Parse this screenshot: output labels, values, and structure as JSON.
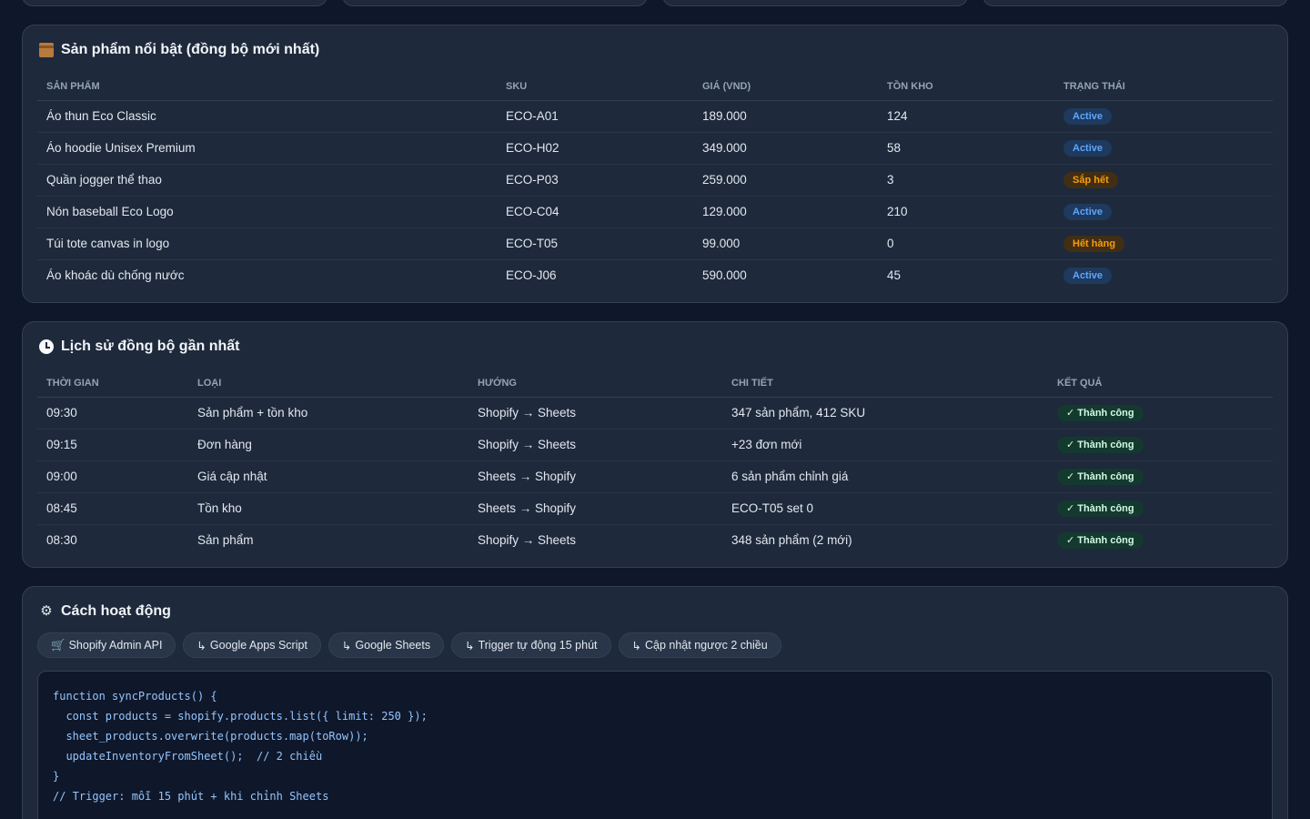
{
  "products": {
    "title": "Sản phẩm nổi bật (đồng bộ mới nhất)",
    "icon": "package-icon",
    "headers": [
      "SẢN PHẨM",
      "SKU",
      "GIÁ (VND)",
      "TỒN KHO",
      "TRẠNG THÁI"
    ],
    "rows": [
      {
        "name": "Áo thun Eco Classic",
        "sku": "ECO-A01",
        "price": "189.000",
        "stock": "124",
        "status": "Active",
        "status_kind": "active"
      },
      {
        "name": "Áo hoodie Unisex Premium",
        "sku": "ECO-H02",
        "price": "349.000",
        "stock": "58",
        "status": "Active",
        "status_kind": "active"
      },
      {
        "name": "Quần jogger thể thao",
        "sku": "ECO-P03",
        "price": "259.000",
        "stock": "3",
        "status": "Sắp hết",
        "status_kind": "warn"
      },
      {
        "name": "Nón baseball Eco Logo",
        "sku": "ECO-C04",
        "price": "129.000",
        "stock": "210",
        "status": "Active",
        "status_kind": "active"
      },
      {
        "name": "Túi tote canvas in logo",
        "sku": "ECO-T05",
        "price": "99.000",
        "stock": "0",
        "status": "Hết hàng",
        "status_kind": "warn"
      },
      {
        "name": "Áo khoác dù chống nước",
        "sku": "ECO-J06",
        "price": "590.000",
        "stock": "45",
        "status": "Active",
        "status_kind": "active"
      }
    ]
  },
  "history": {
    "title": "Lịch sử đồng bộ gần nhất",
    "icon": "clock-icon",
    "headers": [
      "THỜI GIAN",
      "LOẠI",
      "HƯỚNG",
      "CHI TIẾT",
      "KẾT QUẢ"
    ],
    "rows": [
      {
        "time": "09:30",
        "type": "Sản phẩm + tồn kho",
        "direction": "Shopify → Sheets",
        "detail": "347 sản phẩm, 412 SKU",
        "result": "✓ Thành công"
      },
      {
        "time": "09:15",
        "type": "Đơn hàng",
        "direction": "Shopify → Sheets",
        "detail": "+23 đơn mới",
        "result": "✓ Thành công"
      },
      {
        "time": "09:00",
        "type": "Giá cập nhật",
        "direction": "Sheets → Shopify",
        "detail": "6 sản phẩm chỉnh giá",
        "result": "✓ Thành công"
      },
      {
        "time": "08:45",
        "type": "Tồn kho",
        "direction": "Sheets → Shopify",
        "detail": "ECO-T05 set 0",
        "result": "✓ Thành công"
      },
      {
        "time": "08:30",
        "type": "Sản phẩm",
        "direction": "Shopify → Sheets",
        "detail": "348 sản phẩm (2 mới)",
        "result": "✓ Thành công"
      }
    ]
  },
  "how": {
    "title": "Cách hoạt động",
    "icon": "gear-icon",
    "chips": [
      {
        "icon": "cart-icon",
        "prefix": "🛒",
        "label": "Shopify Admin API"
      },
      {
        "icon": "arrow-icon",
        "prefix": "↳",
        "label": "Google Apps Script"
      },
      {
        "icon": "arrow-icon",
        "prefix": "↳",
        "label": "Google Sheets"
      },
      {
        "icon": "arrow-icon",
        "prefix": "↳",
        "label": "Trigger tự động 15 phút"
      },
      {
        "icon": "arrow-icon",
        "prefix": "↳",
        "label": "Cập nhật ngược 2 chiều"
      }
    ],
    "code": [
      "function syncProducts() {",
      "  const products = shopify.products.list({ limit: 250 });",
      "  sheet_products.overwrite(products.map(toRow));",
      "  updateInventoryFromSheet();  // 2 chiều",
      "}",
      "// Trigger: mỗi 15 phút + khi chỉnh Sheets"
    ]
  }
}
